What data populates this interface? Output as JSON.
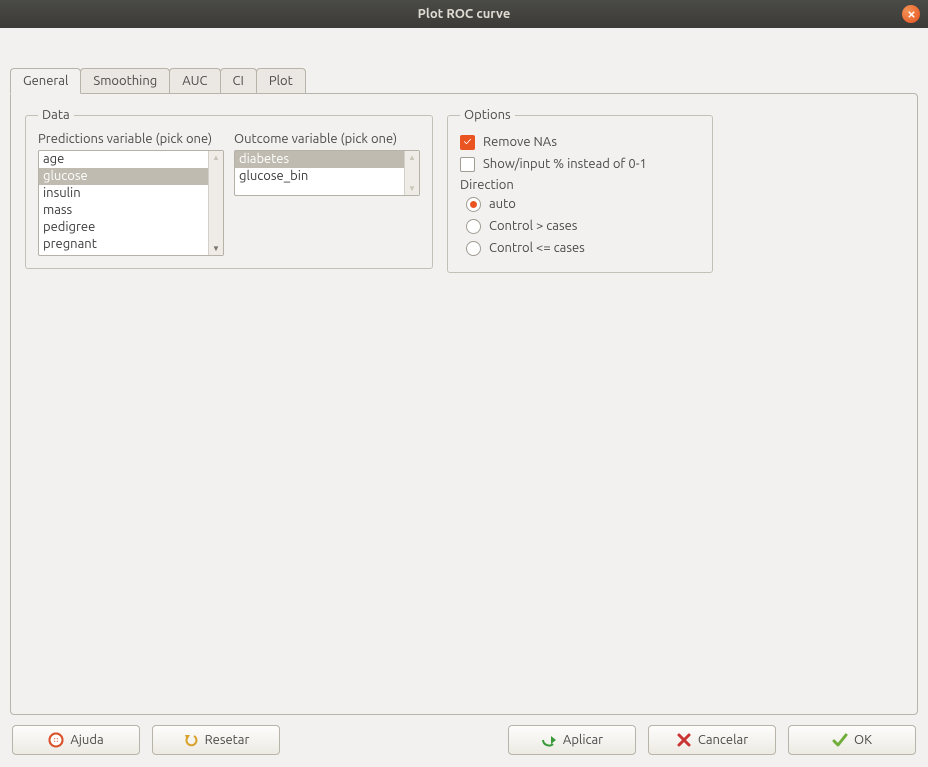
{
  "window": {
    "title": "Plot ROC curve"
  },
  "tabs": [
    {
      "label": "General",
      "active": true
    },
    {
      "label": "Smoothing",
      "active": false
    },
    {
      "label": "AUC",
      "active": false
    },
    {
      "label": "CI",
      "active": false
    },
    {
      "label": "Plot",
      "active": false
    }
  ],
  "data_section": {
    "legend": "Data",
    "predictions_label": "Predictions variable (pick one)",
    "outcome_label": "Outcome variable (pick one)",
    "predictions": [
      {
        "label": "age",
        "selected": false
      },
      {
        "label": "glucose",
        "selected": true
      },
      {
        "label": "insulin",
        "selected": false
      },
      {
        "label": "mass",
        "selected": false
      },
      {
        "label": "pedigree",
        "selected": false
      },
      {
        "label": "pregnant",
        "selected": false
      }
    ],
    "outcomes": [
      {
        "label": "diabetes",
        "selected": true
      },
      {
        "label": "glucose_bin",
        "selected": false
      }
    ]
  },
  "options_section": {
    "legend": "Options",
    "remove_nas": {
      "label": "Remove NAs",
      "checked": true
    },
    "show_pct": {
      "label": "Show/input % instead of 0-1",
      "checked": false
    },
    "direction_label": "Direction",
    "direction": [
      {
        "label": "auto",
        "selected": true
      },
      {
        "label": "Control > cases",
        "selected": false
      },
      {
        "label": "Control <= cases",
        "selected": false
      }
    ]
  },
  "buttons": {
    "help": "Ajuda",
    "reset": "Resetar",
    "apply": "Aplicar",
    "cancel": "Cancelar",
    "ok": "OK"
  }
}
